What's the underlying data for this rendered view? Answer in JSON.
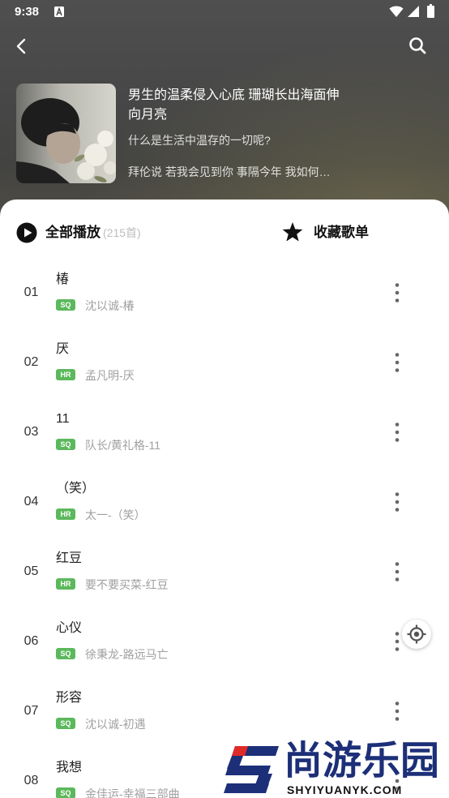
{
  "status_bar": {
    "time": "9:38",
    "icons": [
      "keyboard-a-icon",
      "wifi-icon",
      "signal-icon",
      "battery-icon"
    ]
  },
  "toolbar": {
    "back_icon": "back-arrow-icon",
    "search_icon": "search-icon"
  },
  "playlist": {
    "cover": "playlist-cover-image",
    "title": "男生的温柔侵入心底 珊瑚长出海面伸向月亮",
    "subtitle": "什么是生活中温存的一切呢?",
    "description": "拜伦说 若我会见到你 事隔今年 我如何…"
  },
  "actions": {
    "play_all_icon": "play-circle-icon",
    "play_all_label": "全部播放",
    "song_count": "(215首)",
    "favorite_icon": "star-icon",
    "favorite_label": "收藏歌单"
  },
  "songs": [
    {
      "index": "01",
      "title": "椿",
      "quality": "SQ",
      "artist_album": "沈以诚-椿"
    },
    {
      "index": "02",
      "title": "厌",
      "quality": "HR",
      "artist_album": "孟凡明-厌"
    },
    {
      "index": "03",
      "title": "11",
      "quality": "SQ",
      "artist_album": "队长/黄礼格-11"
    },
    {
      "index": "04",
      "title": "（笑）",
      "quality": "HR",
      "artist_album": "太一-（笑）"
    },
    {
      "index": "05",
      "title": "红豆",
      "quality": "HR",
      "artist_album": "要不要买菜-红豆"
    },
    {
      "index": "06",
      "title": "心仪",
      "quality": "SQ",
      "artist_album": "徐秉龙-路远马亡"
    },
    {
      "index": "07",
      "title": "形容",
      "quality": "SQ",
      "artist_album": "沈以诚-初遇"
    },
    {
      "index": "08",
      "title": "我想",
      "quality": "SQ",
      "artist_album": "金佳运-幸福三部曲"
    }
  ],
  "song_more_icon": "more-vertical-icon",
  "locate_icon": "locate-crosshair-icon",
  "watermark": {
    "logo": "s-logo",
    "brand": "尚游乐园",
    "site": "SHYIYUANYK.COM"
  },
  "colors": {
    "header_bg": "#4a4a4a",
    "panel_bg": "#ffffff",
    "badge_green": "#5cb85c",
    "text_primary": "#222222",
    "text_secondary": "#a0a0a0",
    "watermark_navy": "#1c2f78",
    "watermark_red": "#e02a2a"
  }
}
